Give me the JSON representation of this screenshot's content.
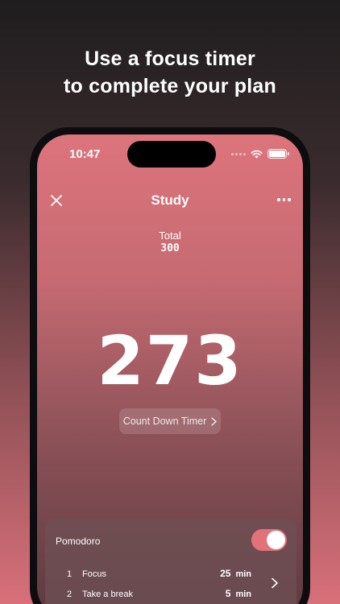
{
  "headline": {
    "line1": "Use a focus timer",
    "line2": "to complete your plan"
  },
  "status_bar": {
    "time": "10:47"
  },
  "nav": {
    "title": "Study"
  },
  "total": {
    "label": "Total",
    "value": "300"
  },
  "timer": {
    "value": "273",
    "mode_label": "Count Down Timer"
  },
  "pomodoro": {
    "title": "Pomodoro",
    "enabled": true,
    "steps": [
      {
        "num": "1",
        "label": "Focus",
        "minutes": "25",
        "unit": "min"
      },
      {
        "num": "2",
        "label": "Take a break",
        "minutes": "5",
        "unit": "min"
      }
    ]
  },
  "icons": {
    "close": "close-icon",
    "more": "more-icon",
    "chevron": "chevron-right-icon",
    "wifi": "wifi-icon",
    "battery": "battery-icon",
    "signal": "cellular-signal-icon"
  },
  "colors": {
    "accent": "#e2727a"
  }
}
